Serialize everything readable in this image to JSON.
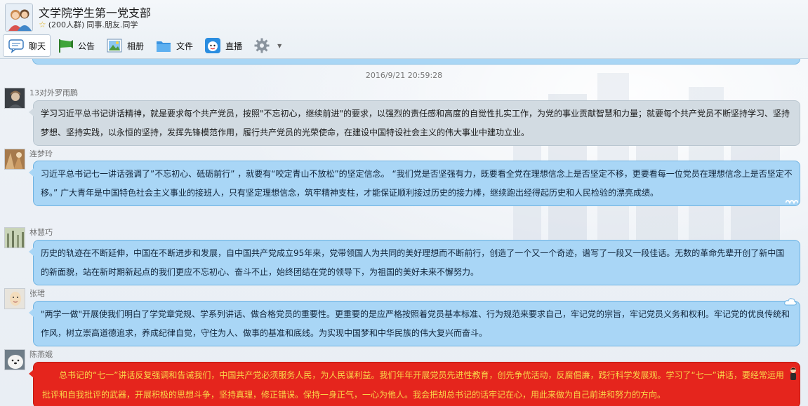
{
  "window": {
    "title": "文学院学生第一党支部",
    "member_count": "(200人群)",
    "tags": "同事.朋友.同学"
  },
  "toolbar": {
    "tabs": [
      {
        "label": "聊天",
        "icon": "chat-bubble-icon",
        "active": true
      },
      {
        "label": "公告",
        "icon": "megaphone-icon",
        "active": false
      },
      {
        "label": "相册",
        "icon": "photo-album-icon",
        "active": false
      },
      {
        "label": "文件",
        "icon": "folder-icon",
        "active": false
      },
      {
        "label": "直播",
        "icon": "live-broadcast-icon",
        "active": false
      }
    ],
    "settings_icon": "gear-icon"
  },
  "chat": {
    "timestamp": "2016/9/21 20:59:28",
    "messages": [
      {
        "sender": "13对外罗雨鹏",
        "style": "gray",
        "text": "学习习近平总书记讲话精神，就是要求每个共产党员，按照\"不忘初心，继续前进\"的要求，以强烈的责任感和高度的自觉性扎实工作，为党的事业贡献智慧和力量；就要每个共产党员不断坚持学习、坚持梦想、坚持实践，以永恒的坚持，发挥先锋模范作用，履行共产党员的光荣使命，在建设中国特设社会主义的伟大事业中建功立业。"
      },
      {
        "sender": "连梦玲",
        "style": "blue",
        "text": "习近平总书记七一讲话强调了”不忘初心、砥砺前行” ，就要有“咬定青山不放松”的坚定信念。 “我们党是否坚强有力，既要看全党在理想信念上是否坚定不移，更要看每一位党员在理想信念上是否坚定不移。” 广大青年是中国特色社会主义事业的接班人，只有坚定理想信念，筑牢精神支柱，才能保证顺利接过历史的接力棒，继续跑出经得起历史和人民检验的漂亮成绩。"
      },
      {
        "sender": "林慧巧",
        "style": "blue",
        "text": "历史的轨迹在不断延伸，中国在不断进步和发展，自中国共产党成立95年来，党带领国人为共同的美好理想而不断前行，创造了一个又一个奇迹，谱写了一段又一段佳话。无数的革命先辈开创了新中国的新面貌，站在新时期新起点的我们更应不忘初心、奋斗不止，始终团结在党的领导下，为祖国的美好未来不懈努力。"
      },
      {
        "sender": "张珺",
        "style": "blue",
        "text": "\"两学一做\"开展使我们明白了学党章党规、学系列讲话、做合格党员的重要性。更重要的是应严格按照着党员基本标准、行为规范来要求自己，牢记党的宗旨，牢记党员义务和权利。牢记党的优良传统和作风，树立崇高道德追求，养成纪律自觉，守住为人、做事的基准和底线。为实现中国梦和中华民族的伟大复兴而奋斗。"
      },
      {
        "sender": "陈燕娥",
        "style": "red",
        "text": "总书记的“七一”讲话反复强调和告诫我们，中国共产党必须服务人民，为人民谋利益。我们年年开展党员先进性教育，创先争优活动，反腐倡廉，践行科学发展观。学习了“七一”讲话，要经常运用批评和自我批评的武器，开展积极的思想斗争，坚持真理，修正错误。保持一身正气，一心为他人。我会把胡总书记的话牢记在心，用此来做为自己前进和努力的方向。"
      }
    ]
  },
  "colors": {
    "bubble_gray": "#d2dbe2",
    "bubble_blue": "#a9d6f6",
    "bubble_red": "#e5251d",
    "red_text": "#f9d64a"
  }
}
